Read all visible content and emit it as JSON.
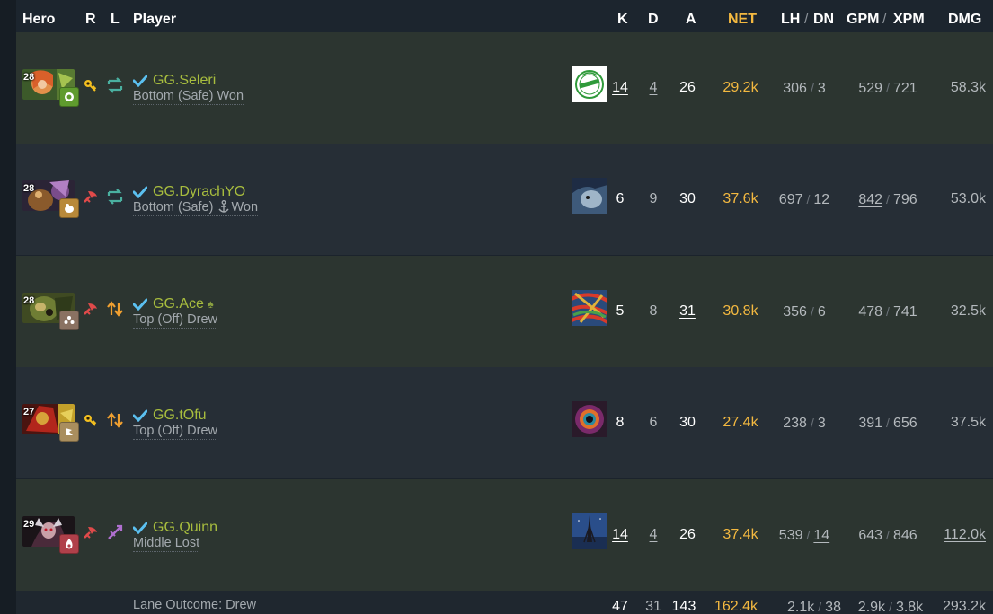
{
  "headers": {
    "hero": "Hero",
    "role": "R",
    "lane": "L",
    "player": "Player",
    "kills": "K",
    "deaths": "D",
    "assists": "A",
    "net": "NET",
    "lh": "LH",
    "dn": "DN",
    "gpm": "GPM",
    "xpm": "XPM",
    "dmg": "DMG",
    "slash": "/"
  },
  "colors": {
    "net": "#f4b940",
    "player_name": "#a8bd3e",
    "verified": "#5bc0f0",
    "row_alt_1": "#2c3530",
    "row_alt_2": "#262e36"
  },
  "players": [
    {
      "level": "28",
      "hero_icon": "windranger-portrait",
      "facet_icon": "facet-green-icon",
      "facet_color": "#5f9b2e",
      "role_icon": "core-key-icon",
      "lane_icon": "safe-lane-icon",
      "name": "GG.Seleri",
      "lane_text": "Bottom (Safe) Won",
      "badge": "",
      "kills": "14",
      "deaths": "4",
      "assists": "26",
      "net": "29.2k",
      "lh": "306",
      "dn": "3",
      "gpm": "529",
      "xpm": "721",
      "dmg": "58.3k",
      "u": {
        "kills": true,
        "deaths": true,
        "assists": false,
        "lh": false,
        "dn": false,
        "gpm": false,
        "dmg": false
      }
    },
    {
      "level": "28",
      "hero_icon": "alchemist-portrait",
      "facet_icon": "facet-gold-icon",
      "facet_color": "#b8893a",
      "role_icon": "support-icon",
      "lane_icon": "safe-lane-icon",
      "name": "GG.DyrachYO",
      "lane_text": "Bottom (Safe)",
      "lane_text_extra": "Won",
      "badge": "",
      "kills": "6",
      "deaths": "9",
      "assists": "30",
      "net": "37.6k",
      "lh": "697",
      "dn": "12",
      "gpm": "842",
      "xpm": "796",
      "dmg": "53.0k",
      "u": {
        "kills": false,
        "deaths": false,
        "assists": false,
        "lh": false,
        "dn": false,
        "gpm": true,
        "dmg": false
      }
    },
    {
      "level": "28",
      "hero_icon": "tusk-portrait",
      "facet_icon": "facet-brown-icon",
      "facet_color": "#8a7262",
      "role_icon": "support-icon",
      "lane_icon": "off-lane-icon",
      "name": "GG.Ace",
      "lane_text": "Top (Off) Drew",
      "badge": "♠",
      "kills": "5",
      "deaths": "8",
      "assists": "31",
      "net": "30.8k",
      "lh": "356",
      "dn": "6",
      "gpm": "478",
      "xpm": "741",
      "dmg": "32.5k",
      "u": {
        "kills": false,
        "deaths": false,
        "assists": true,
        "lh": false,
        "dn": false,
        "gpm": false,
        "dmg": false
      }
    },
    {
      "level": "27",
      "hero_icon": "mars-portrait",
      "facet_icon": "facet-tan-icon",
      "facet_color": "#a98e5e",
      "role_icon": "core-key-icon",
      "lane_icon": "off-lane-icon",
      "name": "GG.tOfu",
      "lane_text": "Top (Off) Drew",
      "badge": "",
      "kills": "8",
      "deaths": "6",
      "assists": "30",
      "net": "27.4k",
      "lh": "238",
      "dn": "3",
      "gpm": "391",
      "xpm": "656",
      "dmg": "37.5k",
      "u": {
        "kills": false,
        "deaths": false,
        "assists": false,
        "lh": false,
        "dn": false,
        "gpm": false,
        "dmg": false
      }
    },
    {
      "level": "29",
      "hero_icon": "queen-of-pain-portrait",
      "facet_icon": "facet-red-icon",
      "facet_color": "#b0404a",
      "role_icon": "support-icon",
      "lane_icon": "mid-lane-icon",
      "name": "GG.Quinn",
      "lane_text": "Middle Lost",
      "badge": "",
      "kills": "14",
      "deaths": "4",
      "assists": "26",
      "net": "37.4k",
      "lh": "539",
      "dn": "14",
      "gpm": "643",
      "xpm": "846",
      "dmg": "112.0k",
      "u": {
        "kills": true,
        "deaths": true,
        "assists": false,
        "lh": false,
        "dn": true,
        "gpm": false,
        "dmg": true
      }
    }
  ],
  "totals": {
    "lane_outcome": "Lane Outcome: Drew",
    "kills": "47",
    "deaths": "31",
    "assists": "143",
    "net": "162.4k",
    "lh": "2.1k",
    "dn": "38",
    "gpm": "2.9k",
    "xpm": "3.8k",
    "dmg": "293.2k"
  }
}
